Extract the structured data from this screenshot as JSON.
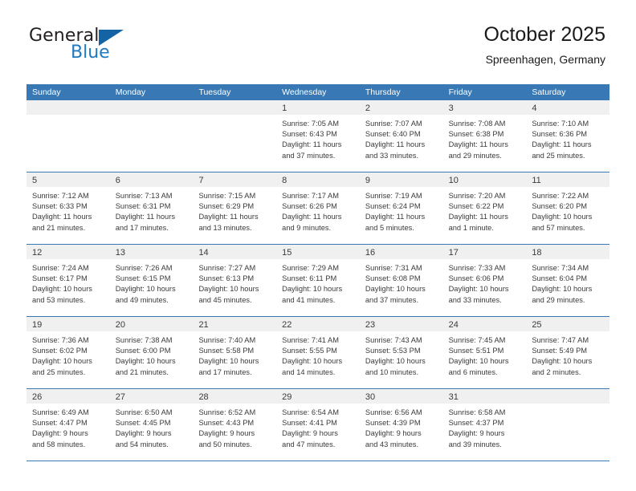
{
  "brand": {
    "name_part1": "General",
    "name_part2": "Blue"
  },
  "header": {
    "title": "October 2025",
    "subtitle": "Spreenhagen, Germany"
  },
  "colors": {
    "header_blue": "#3878b4",
    "logo_blue": "#1f7ac0",
    "logo_triangle": "#1464a5",
    "day_strip_gray": "#f0f0f0",
    "text": "#3a3a3a"
  },
  "weekdays": [
    "Sunday",
    "Monday",
    "Tuesday",
    "Wednesday",
    "Thursday",
    "Friday",
    "Saturday"
  ],
  "weeks": [
    [
      {
        "day": "",
        "lines": []
      },
      {
        "day": "",
        "lines": []
      },
      {
        "day": "",
        "lines": []
      },
      {
        "day": "1",
        "lines": [
          "Sunrise: 7:05 AM",
          "Sunset: 6:43 PM",
          "Daylight: 11 hours",
          "and 37 minutes."
        ]
      },
      {
        "day": "2",
        "lines": [
          "Sunrise: 7:07 AM",
          "Sunset: 6:40 PM",
          "Daylight: 11 hours",
          "and 33 minutes."
        ]
      },
      {
        "day": "3",
        "lines": [
          "Sunrise: 7:08 AM",
          "Sunset: 6:38 PM",
          "Daylight: 11 hours",
          "and 29 minutes."
        ]
      },
      {
        "day": "4",
        "lines": [
          "Sunrise: 7:10 AM",
          "Sunset: 6:36 PM",
          "Daylight: 11 hours",
          "and 25 minutes."
        ]
      }
    ],
    [
      {
        "day": "5",
        "lines": [
          "Sunrise: 7:12 AM",
          "Sunset: 6:33 PM",
          "Daylight: 11 hours",
          "and 21 minutes."
        ]
      },
      {
        "day": "6",
        "lines": [
          "Sunrise: 7:13 AM",
          "Sunset: 6:31 PM",
          "Daylight: 11 hours",
          "and 17 minutes."
        ]
      },
      {
        "day": "7",
        "lines": [
          "Sunrise: 7:15 AM",
          "Sunset: 6:29 PM",
          "Daylight: 11 hours",
          "and 13 minutes."
        ]
      },
      {
        "day": "8",
        "lines": [
          "Sunrise: 7:17 AM",
          "Sunset: 6:26 PM",
          "Daylight: 11 hours",
          "and 9 minutes."
        ]
      },
      {
        "day": "9",
        "lines": [
          "Sunrise: 7:19 AM",
          "Sunset: 6:24 PM",
          "Daylight: 11 hours",
          "and 5 minutes."
        ]
      },
      {
        "day": "10",
        "lines": [
          "Sunrise: 7:20 AM",
          "Sunset: 6:22 PM",
          "Daylight: 11 hours",
          "and 1 minute."
        ]
      },
      {
        "day": "11",
        "lines": [
          "Sunrise: 7:22 AM",
          "Sunset: 6:20 PM",
          "Daylight: 10 hours",
          "and 57 minutes."
        ]
      }
    ],
    [
      {
        "day": "12",
        "lines": [
          "Sunrise: 7:24 AM",
          "Sunset: 6:17 PM",
          "Daylight: 10 hours",
          "and 53 minutes."
        ]
      },
      {
        "day": "13",
        "lines": [
          "Sunrise: 7:26 AM",
          "Sunset: 6:15 PM",
          "Daylight: 10 hours",
          "and 49 minutes."
        ]
      },
      {
        "day": "14",
        "lines": [
          "Sunrise: 7:27 AM",
          "Sunset: 6:13 PM",
          "Daylight: 10 hours",
          "and 45 minutes."
        ]
      },
      {
        "day": "15",
        "lines": [
          "Sunrise: 7:29 AM",
          "Sunset: 6:11 PM",
          "Daylight: 10 hours",
          "and 41 minutes."
        ]
      },
      {
        "day": "16",
        "lines": [
          "Sunrise: 7:31 AM",
          "Sunset: 6:08 PM",
          "Daylight: 10 hours",
          "and 37 minutes."
        ]
      },
      {
        "day": "17",
        "lines": [
          "Sunrise: 7:33 AM",
          "Sunset: 6:06 PM",
          "Daylight: 10 hours",
          "and 33 minutes."
        ]
      },
      {
        "day": "18",
        "lines": [
          "Sunrise: 7:34 AM",
          "Sunset: 6:04 PM",
          "Daylight: 10 hours",
          "and 29 minutes."
        ]
      }
    ],
    [
      {
        "day": "19",
        "lines": [
          "Sunrise: 7:36 AM",
          "Sunset: 6:02 PM",
          "Daylight: 10 hours",
          "and 25 minutes."
        ]
      },
      {
        "day": "20",
        "lines": [
          "Sunrise: 7:38 AM",
          "Sunset: 6:00 PM",
          "Daylight: 10 hours",
          "and 21 minutes."
        ]
      },
      {
        "day": "21",
        "lines": [
          "Sunrise: 7:40 AM",
          "Sunset: 5:58 PM",
          "Daylight: 10 hours",
          "and 17 minutes."
        ]
      },
      {
        "day": "22",
        "lines": [
          "Sunrise: 7:41 AM",
          "Sunset: 5:55 PM",
          "Daylight: 10 hours",
          "and 14 minutes."
        ]
      },
      {
        "day": "23",
        "lines": [
          "Sunrise: 7:43 AM",
          "Sunset: 5:53 PM",
          "Daylight: 10 hours",
          "and 10 minutes."
        ]
      },
      {
        "day": "24",
        "lines": [
          "Sunrise: 7:45 AM",
          "Sunset: 5:51 PM",
          "Daylight: 10 hours",
          "and 6 minutes."
        ]
      },
      {
        "day": "25",
        "lines": [
          "Sunrise: 7:47 AM",
          "Sunset: 5:49 PM",
          "Daylight: 10 hours",
          "and 2 minutes."
        ]
      }
    ],
    [
      {
        "day": "26",
        "lines": [
          "Sunrise: 6:49 AM",
          "Sunset: 4:47 PM",
          "Daylight: 9 hours",
          "and 58 minutes."
        ]
      },
      {
        "day": "27",
        "lines": [
          "Sunrise: 6:50 AM",
          "Sunset: 4:45 PM",
          "Daylight: 9 hours",
          "and 54 minutes."
        ]
      },
      {
        "day": "28",
        "lines": [
          "Sunrise: 6:52 AM",
          "Sunset: 4:43 PM",
          "Daylight: 9 hours",
          "and 50 minutes."
        ]
      },
      {
        "day": "29",
        "lines": [
          "Sunrise: 6:54 AM",
          "Sunset: 4:41 PM",
          "Daylight: 9 hours",
          "and 47 minutes."
        ]
      },
      {
        "day": "30",
        "lines": [
          "Sunrise: 6:56 AM",
          "Sunset: 4:39 PM",
          "Daylight: 9 hours",
          "and 43 minutes."
        ]
      },
      {
        "day": "31",
        "lines": [
          "Sunrise: 6:58 AM",
          "Sunset: 4:37 PM",
          "Daylight: 9 hours",
          "and 39 minutes."
        ]
      },
      {
        "day": "",
        "lines": []
      }
    ]
  ]
}
